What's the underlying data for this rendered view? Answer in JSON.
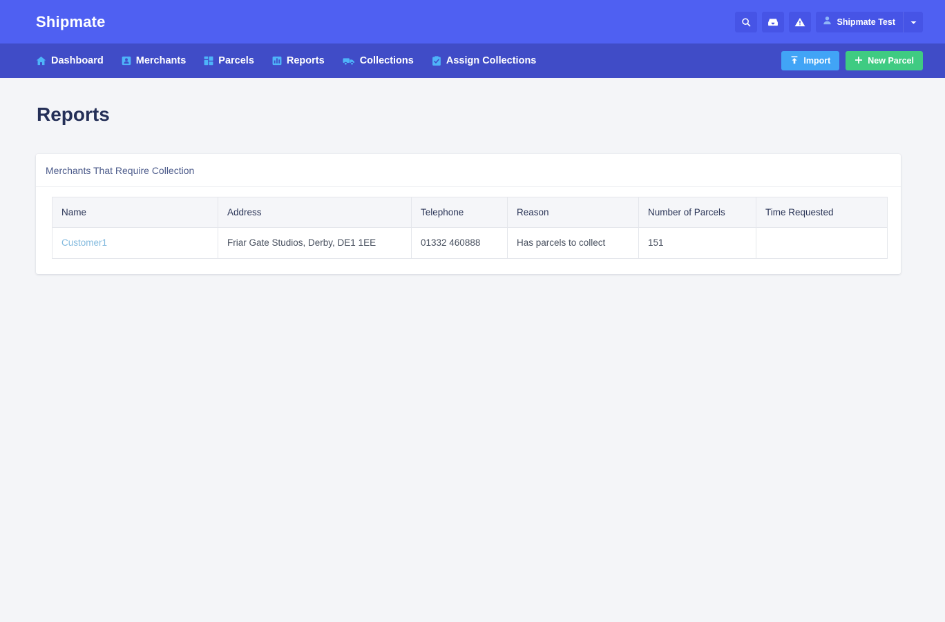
{
  "app": {
    "brand": "Shipmate",
    "colors": {
      "topbar": "#4f60f2",
      "navbar": "#404cc7",
      "import_button": "#41a4f6",
      "new_parcel_button": "#3fcb82",
      "link": "#83bade",
      "page_background": "#f4f5f8"
    }
  },
  "topbar": {
    "actions": [
      {
        "name": "search-icon",
        "label": ""
      },
      {
        "name": "inbox-icon",
        "label": ""
      },
      {
        "name": "warning-icon",
        "label": ""
      }
    ],
    "user": {
      "label": "Shipmate Test",
      "icon": "user-icon",
      "caret": "chevron-down-icon"
    }
  },
  "nav": {
    "items": [
      {
        "label": "Dashboard",
        "icon": "home-icon"
      },
      {
        "label": "Merchants",
        "icon": "merchant-card-icon"
      },
      {
        "label": "Parcels",
        "icon": "grid-icon"
      },
      {
        "label": "Reports",
        "icon": "bar-chart-icon"
      },
      {
        "label": "Collections",
        "icon": "truck-icon"
      },
      {
        "label": "Assign Collections",
        "icon": "clipboard-check-icon"
      }
    ],
    "buttons": {
      "import": {
        "label": "Import",
        "icon": "upload-icon"
      },
      "new_parcel": {
        "label": "New Parcel",
        "icon": "plus-icon"
      }
    }
  },
  "main": {
    "page_title": "Reports",
    "card": {
      "title": "Merchants That Require Collection",
      "table": {
        "columns": [
          "Name",
          "Address",
          "Telephone",
          "Reason",
          "Number of Parcels",
          "Time Requested"
        ],
        "rows": [
          {
            "name": "Customer1",
            "address": "Friar Gate Studios, Derby, DE1 1EE",
            "telephone": "01332 460888",
            "reason": "Has parcels to collect",
            "number_of_parcels": "151",
            "time_requested": ""
          }
        ]
      }
    }
  }
}
